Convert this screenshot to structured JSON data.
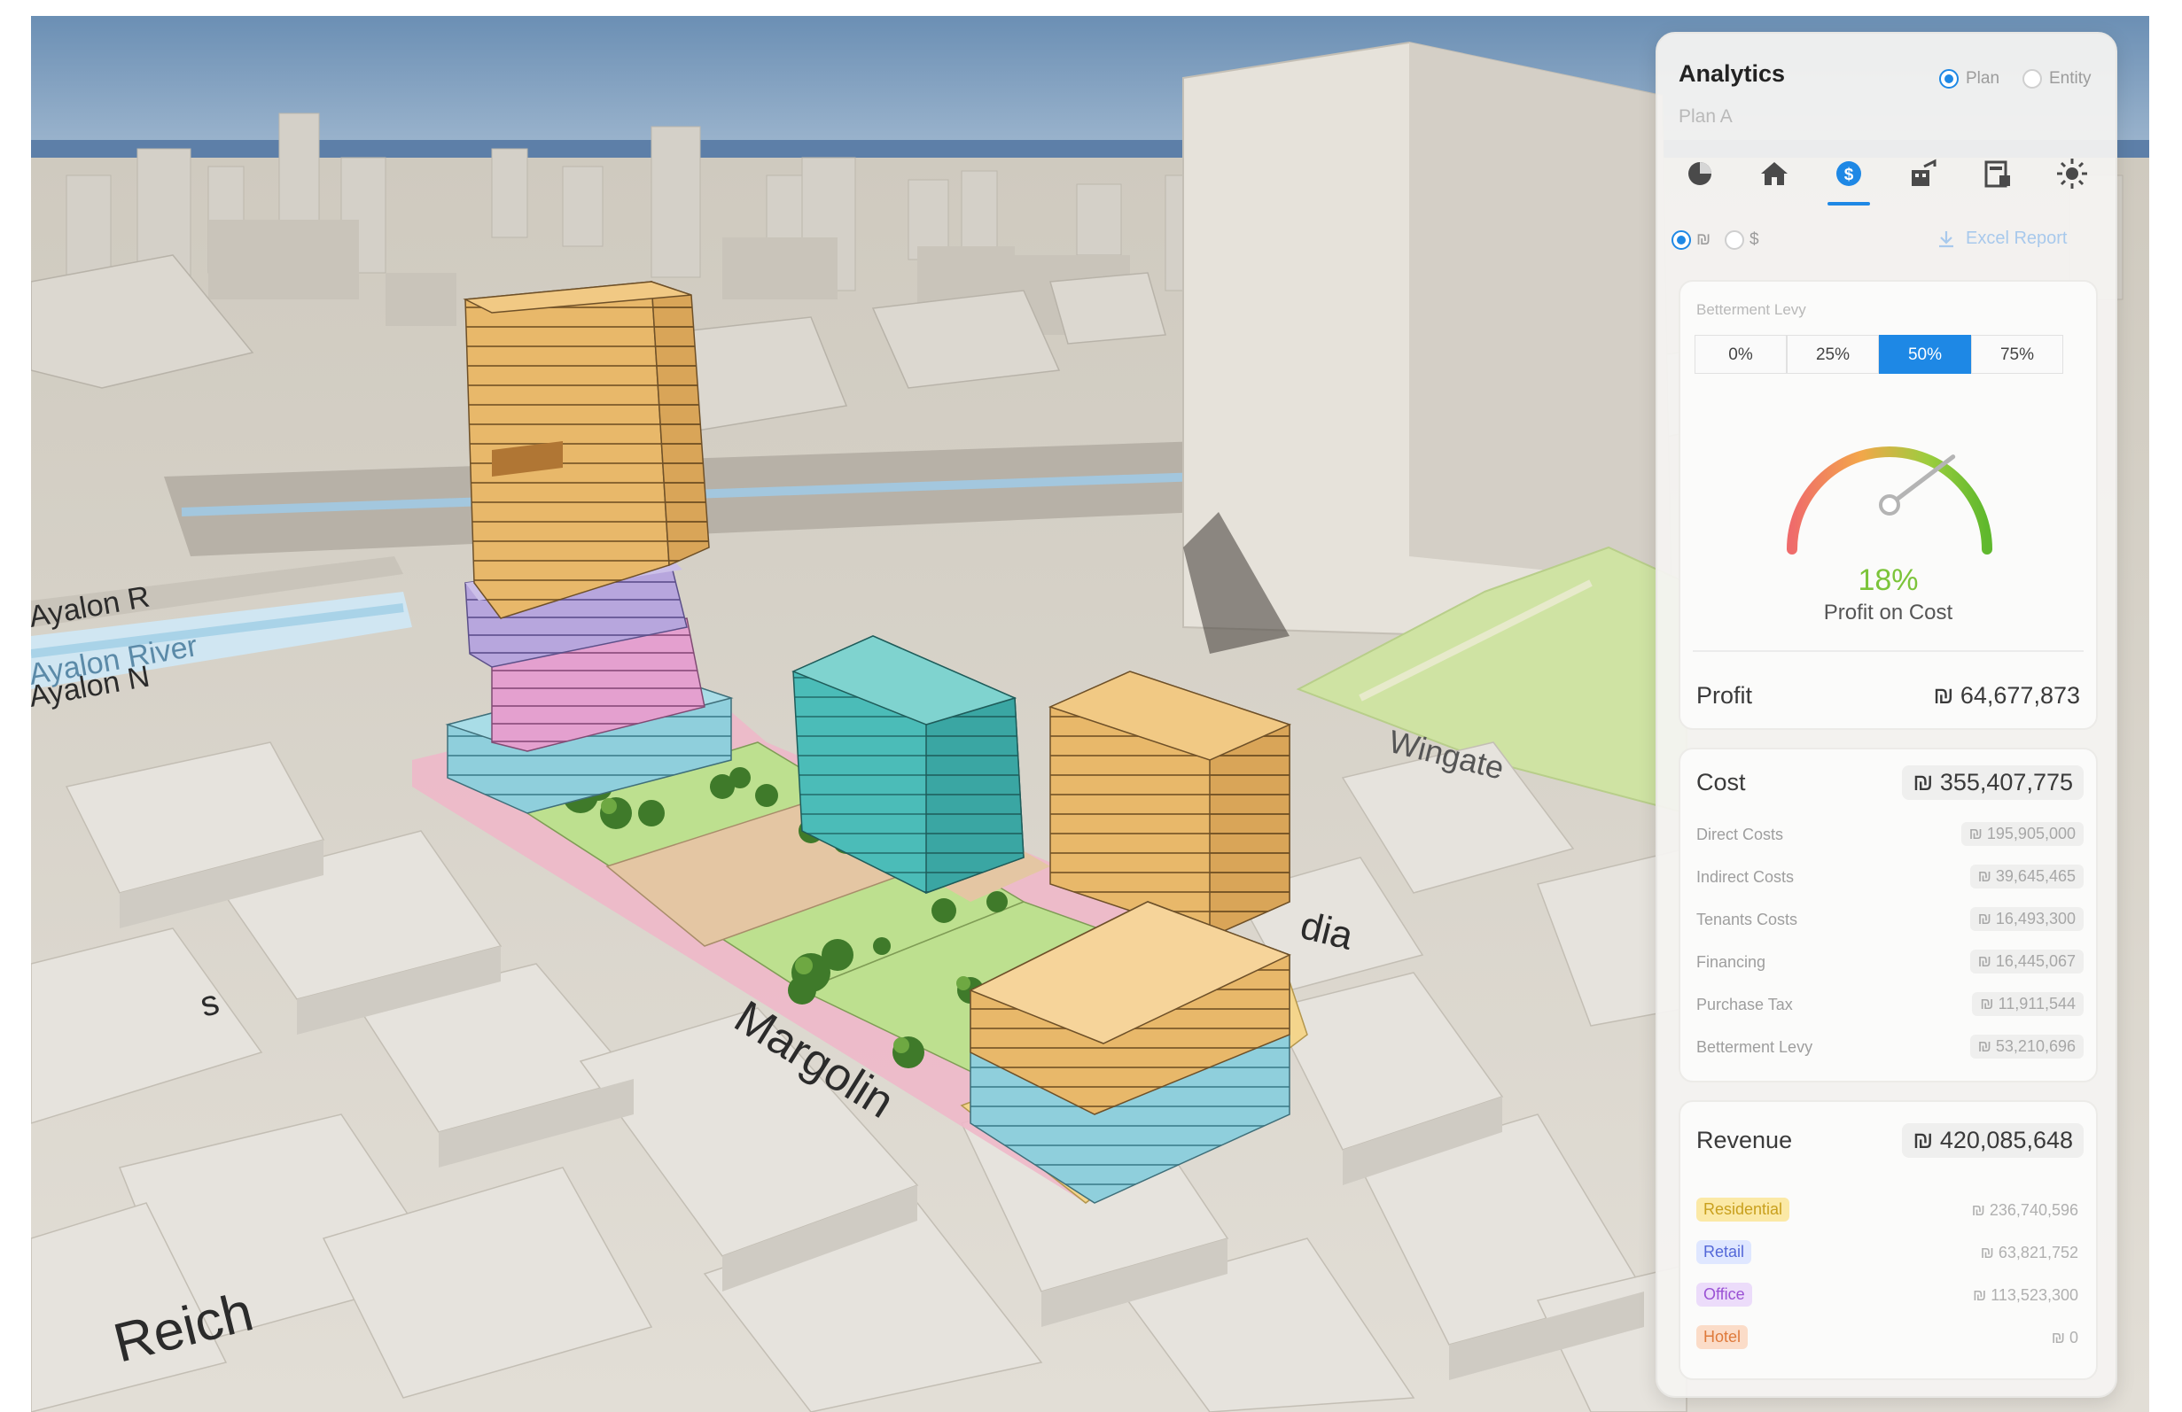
{
  "map_labels": {
    "river_upper": "Ayalon R",
    "river_lower_1": "Ayalon River",
    "river_lower_2": "Ayalon N",
    "street_margolin": "Margolin",
    "street_wingate": "Wingate",
    "street_reich": "Reich",
    "street_dia": "dia",
    "street_s": "s"
  },
  "panel": {
    "title": "Analytics",
    "subtitle": "Plan A",
    "mode_options": [
      {
        "label": "Plan",
        "selected": true
      },
      {
        "label": "Entity",
        "selected": false
      }
    ],
    "tabs": [
      {
        "icon": "pie-chart-icon",
        "active": false
      },
      {
        "icon": "home-icon",
        "active": false
      },
      {
        "icon": "dollar-icon",
        "active": true
      },
      {
        "icon": "building-chart-icon",
        "active": false
      },
      {
        "icon": "calendar-building-icon",
        "active": false
      },
      {
        "icon": "sun-icon",
        "active": false
      }
    ],
    "currency_options": [
      {
        "label": "₪",
        "selected": true
      },
      {
        "label": "$",
        "selected": false
      }
    ],
    "export_label": "Excel Report",
    "betterment": {
      "label": "Betterment Levy",
      "options": [
        "0%",
        "25%",
        "50%",
        "75%"
      ],
      "selected_index": 2
    },
    "gauge": {
      "value_text": "18%",
      "value_fraction": 0.72,
      "label": "Profit on Cost"
    },
    "profit": {
      "label": "Profit",
      "value": "₪ 64,677,873"
    },
    "cost": {
      "label": "Cost",
      "value": "₪ 355,407,775",
      "rows": [
        {
          "label": "Direct Costs",
          "value": "₪ 195,905,000"
        },
        {
          "label": "Indirect Costs",
          "value": "₪ 39,645,465"
        },
        {
          "label": "Tenants Costs",
          "value": "₪ 16,493,300"
        },
        {
          "label": "Financing",
          "value": "₪ 16,445,067"
        },
        {
          "label": "Purchase Tax",
          "value": "₪ 11,911,544"
        },
        {
          "label": "Betterment Levy",
          "value": "₪ 53,210,696"
        }
      ]
    },
    "revenue": {
      "label": "Revenue",
      "value": "₪ 420,085,648",
      "rows": [
        {
          "label": "Residential",
          "value": "₪ 236,740,596",
          "chip_bg": "#fbe9a6",
          "chip_fg": "#c9a01e"
        },
        {
          "label": "Retail",
          "value": "₪ 63,821,752",
          "chip_bg": "#dfe7ff",
          "chip_fg": "#5468d8"
        },
        {
          "label": "Office",
          "value": "₪ 113,523,300",
          "chip_bg": "#ecdcfa",
          "chip_fg": "#9a52d4"
        },
        {
          "label": "Hotel",
          "value": "₪ 0",
          "chip_bg": "#fbdcc8",
          "chip_fg": "#df7a3b"
        }
      ]
    }
  },
  "colors": {
    "accent": "#1e88e5",
    "gauge_green": "#7cc43a",
    "residential": "#e8b86a",
    "retail": "#8fcfdc",
    "office": "#b7a6dd",
    "hotel": "#e4a0cf",
    "teal_block": "#4bbcb8",
    "green_space": "#bde08f"
  }
}
